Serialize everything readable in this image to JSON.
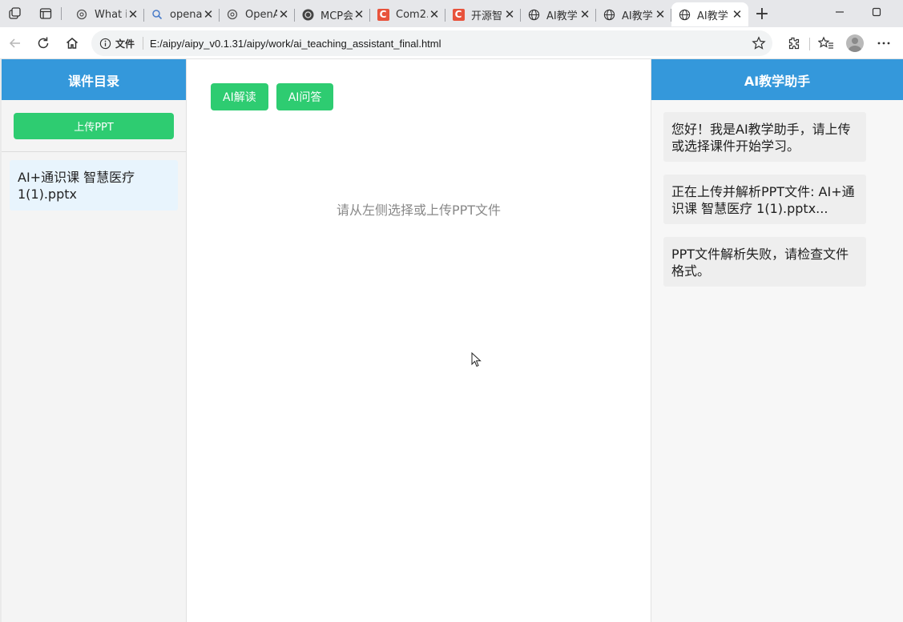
{
  "browser": {
    "tabs": [
      {
        "title": "What i",
        "favicon": "openai-icon"
      },
      {
        "title": "opena",
        "favicon": "search-icon"
      },
      {
        "title": "OpenA",
        "favicon": "openai-icon"
      },
      {
        "title": "MCP会",
        "favicon": "openai-dark-icon"
      },
      {
        "title": "Com2.",
        "favicon": "c-icon",
        "favicon_letter": "C"
      },
      {
        "title": "开源智",
        "favicon": "c-icon",
        "favicon_letter": "C"
      },
      {
        "title": "AI教学",
        "favicon": "globe-icon"
      },
      {
        "title": "AI教学",
        "favicon": "globe-icon"
      },
      {
        "title": "AI教学",
        "favicon": "globe-icon",
        "active": true
      }
    ],
    "address": {
      "security_label": "文件",
      "url": "E:/aipy/aipy_v0.1.31/aipy/work/ai_teaching_assistant_final.html"
    }
  },
  "sidebar": {
    "title": "课件目录",
    "upload_label": "上传PPT",
    "items": [
      {
        "label": "AI+通识课 智慧医疗 1(1).pptx"
      }
    ]
  },
  "main": {
    "buttons": {
      "interpret_label": "AI解读",
      "qa_label": "AI问答"
    },
    "placeholder": "请从左侧选择或上传PPT文件"
  },
  "assistant": {
    "title": "AI教学助手",
    "messages": [
      {
        "text": "您好！我是AI教学助手，请上传或选择课件开始学习。"
      },
      {
        "text": "正在上传并解析PPT文件: AI+通识课 智慧医疗 1(1).pptx..."
      },
      {
        "text": "PPT文件解析失败，请检查文件格式。"
      }
    ]
  },
  "colors": {
    "header_blue": "#3498db",
    "button_green": "#2ecc71",
    "selected_item": "#e8f4fd",
    "placeholder_gray": "#888888"
  }
}
